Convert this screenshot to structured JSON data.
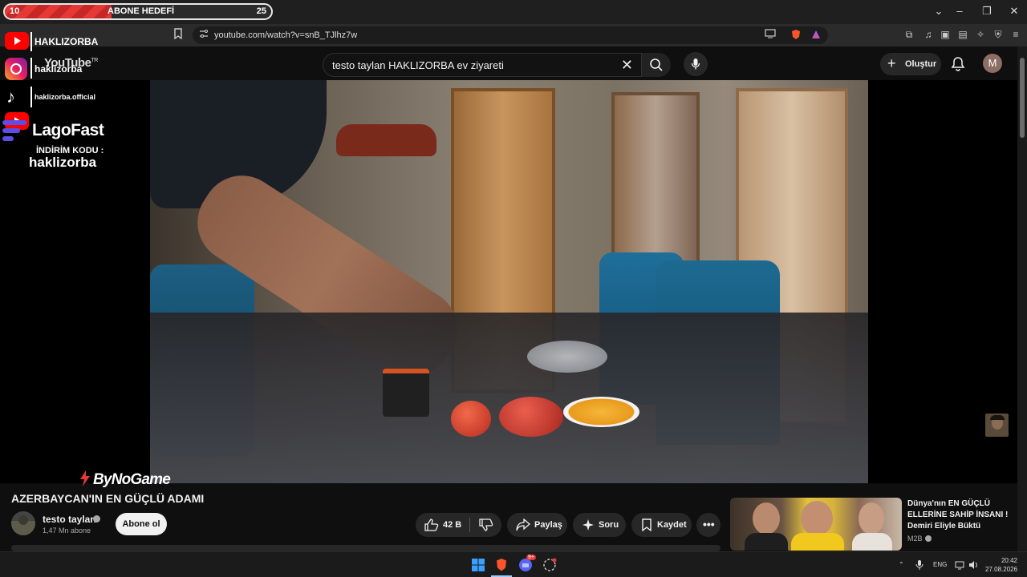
{
  "goal": {
    "start": "10",
    "label": "ABONE HEDEFİ",
    "end": "25",
    "progress": 0.4
  },
  "browser": {
    "url": "youtube.com/watch?v=snB_TJlhz7w"
  },
  "header": {
    "logo": "YouTube",
    "region": "TR",
    "search_value": "testo taylan HAKLIZORBA ev ziyareti",
    "create_label": "Oluştur",
    "avatar_letter": "M"
  },
  "overlay": {
    "youtube_handle": "HAKLIZORBA",
    "instagram_handle": "haklizorba",
    "tiktok_handle": "haklizorba.official",
    "sponsor": "LagoFast",
    "discount_label": "İNDİRİM KODU :",
    "discount_code": "haklizorba",
    "bottom_sponsor": "ByNoGame"
  },
  "video": {
    "title": "AZERBAYCAN'IN EN GÜÇLÜ ADAMI",
    "channel": "testo taylan",
    "subscribers": "1,47 Mn abone",
    "subscribe_label": "Abone ol",
    "likes": "42 B",
    "share_label": "Paylaş",
    "ask_label": "Soru",
    "save_label": "Kaydet"
  },
  "recommended": {
    "title": "Dünya'nın EN GÜÇLÜ ELLERİNE SAHİP İNSANI ! Demiri Eliyle Büktü",
    "channel": "M2B"
  },
  "taskbar": {
    "lang": "ENG",
    "time": "20:42",
    "date": "27.08.2026",
    "badge": "9+"
  },
  "colors": {
    "accent": "#e53935",
    "background": "#0f0f0f",
    "pill": "#272727"
  }
}
